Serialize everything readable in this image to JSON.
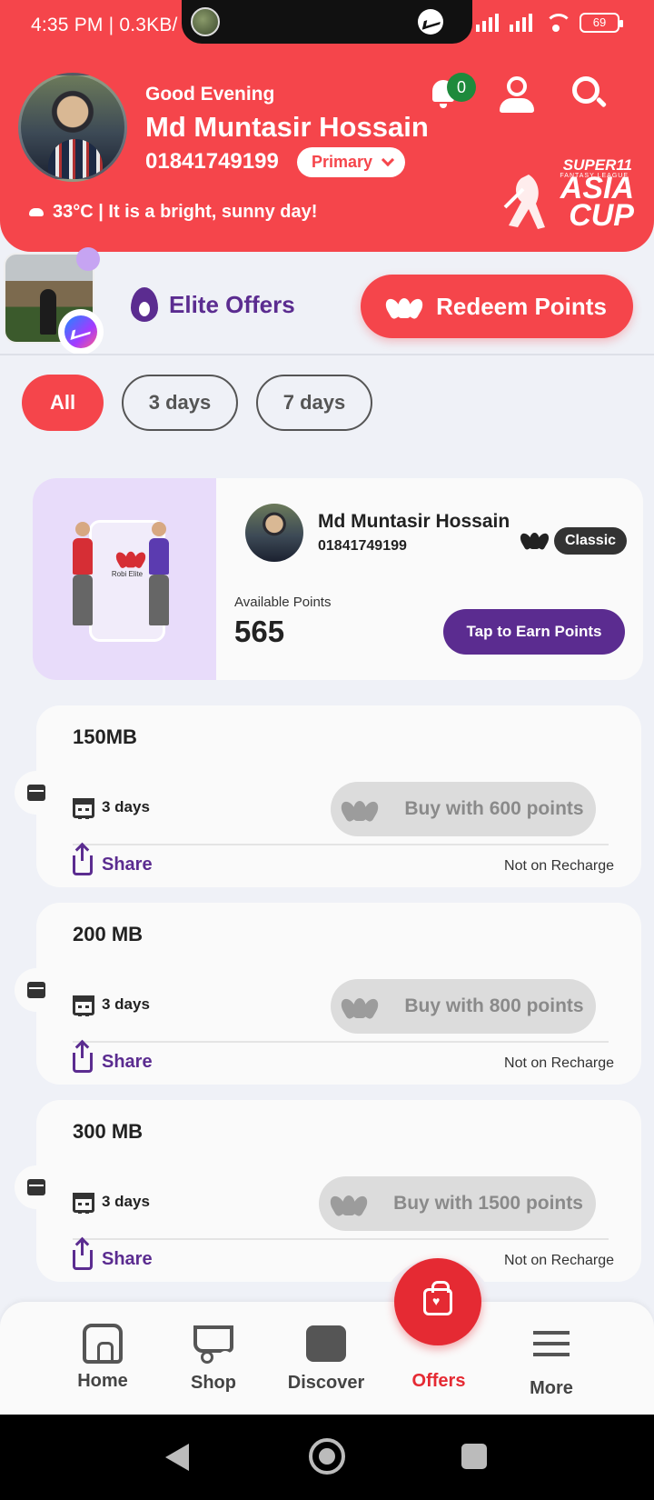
{
  "status_bar": {
    "time": "4:35 PM | 0.3KB/",
    "battery": "69"
  },
  "header": {
    "greeting": "Good Evening",
    "name": "Md Muntasir Hossain",
    "number": "01841749199",
    "account_type": "Primary",
    "weather": "33°C | It is a bright, sunny day!",
    "notification_count": "0",
    "banner": {
      "super": "SUPER11",
      "fantasy_league": "FANTASY LEAGUE",
      "title_line1": "ASIA",
      "title_line2": "CUP"
    }
  },
  "elite_row": {
    "elite_offers_label": "Elite Offers",
    "redeem_label": "Redeem Points"
  },
  "filters": [
    {
      "label": "All",
      "selected": true
    },
    {
      "label": "3 days",
      "selected": false
    },
    {
      "label": "7 days",
      "selected": false
    }
  ],
  "points_card": {
    "illustration_label": "Robi Elite",
    "name": "Md Muntasir Hossain",
    "number": "01841749199",
    "tier": "Classic",
    "available_label": "Available Points",
    "points": "565",
    "earn_button": "Tap to Earn Points"
  },
  "offers": [
    {
      "title": "150MB",
      "validity": "3 days",
      "buy_label": "Buy with 600 points",
      "share_label": "Share",
      "note": "Not on Recharge"
    },
    {
      "title": "200 MB",
      "validity": "3 days",
      "buy_label": "Buy with 800 points",
      "share_label": "Share",
      "note": "Not on Recharge"
    },
    {
      "title": "300 MB",
      "validity": "3 days",
      "buy_label": "Buy with 1500 points",
      "share_label": "Share",
      "note": "Not on Recharge"
    }
  ],
  "bottom_nav": [
    {
      "label": "Home",
      "icon": "home-icon"
    },
    {
      "label": "Shop",
      "icon": "cart-icon"
    },
    {
      "label": "Discover",
      "icon": "discover-icon"
    },
    {
      "label": "Offers",
      "icon": "shopping-bag-icon",
      "active": true
    },
    {
      "label": "More",
      "icon": "menu-icon"
    }
  ],
  "colors": {
    "brand_red": "#f5454b",
    "purple": "#5b2c90",
    "badge_green": "#1e8a3c"
  }
}
